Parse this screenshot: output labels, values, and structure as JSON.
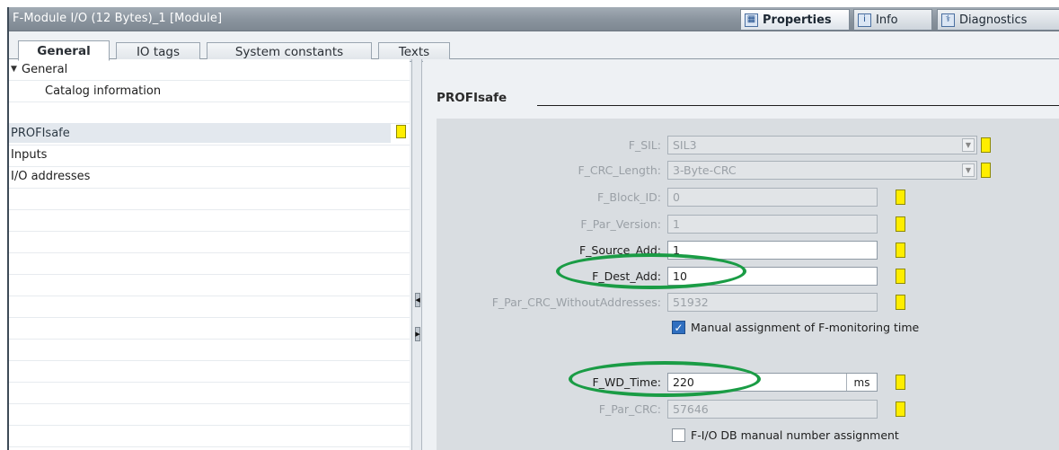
{
  "window": {
    "title": "F-Module I/O (12 Bytes)_1 [Module]",
    "views": [
      {
        "label": "Properties",
        "icon": "properties-icon",
        "active": true
      },
      {
        "label": "Info",
        "icon": "info-icon",
        "active": false
      },
      {
        "label": "Diagnostics",
        "icon": "diagnostics-icon",
        "active": false
      }
    ]
  },
  "tabs": [
    "General",
    "IO tags",
    "System constants",
    "Texts"
  ],
  "nav": {
    "items": [
      {
        "label": "General",
        "expanded": true
      },
      {
        "label": "Catalog information"
      },
      {
        "label": "PROFIsafe",
        "selected": true
      },
      {
        "label": "Inputs"
      },
      {
        "label": "I/O addresses"
      }
    ]
  },
  "section": {
    "title": "PROFIsafe"
  },
  "fields": {
    "f_sil": {
      "label": "F_SIL:",
      "value": "SIL3"
    },
    "f_crc_length": {
      "label": "F_CRC_Length:",
      "value": "3-Byte-CRC"
    },
    "f_block_id": {
      "label": "F_Block_ID:",
      "value": "0"
    },
    "f_par_version": {
      "label": "F_Par_Version:",
      "value": "1"
    },
    "f_source_add": {
      "label": "F_Source_Add:",
      "value": "1"
    },
    "f_dest_add": {
      "label": "F_Dest_Add:",
      "value": "10"
    },
    "f_par_crc_without": {
      "label": "F_Par_CRC_WithoutAddresses:",
      "value": "51932"
    },
    "manual_monitoring": {
      "label": "Manual assignment of F-monitoring time",
      "checked": true
    },
    "f_wd_time": {
      "label": "F_WD_Time:",
      "value": "220",
      "unit": "ms"
    },
    "f_par_crc": {
      "label": "F_Par_CRC:",
      "value": "57646"
    },
    "fio_db_manual": {
      "label": "F-I/O DB manual number assignment",
      "checked": false
    }
  },
  "colors": {
    "highlight_ring": "#1a9c45",
    "indicator": "#ffee00"
  }
}
